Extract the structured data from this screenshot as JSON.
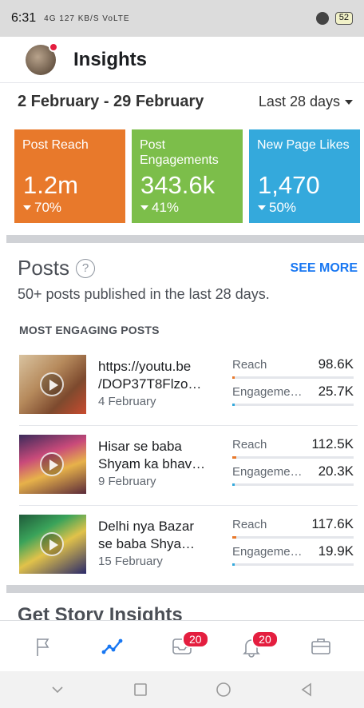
{
  "status_bar": {
    "time": "6:31",
    "indicators": "4G 127 KB/S VoLTE",
    "battery": "52"
  },
  "header": {
    "title": "Insights"
  },
  "date_row": {
    "range": "2 February - 29 February",
    "period": "Last 28 days"
  },
  "cards": [
    {
      "label": "Post Reach",
      "value": "1.2m",
      "change": "70%",
      "color": "#e8792b"
    },
    {
      "label": "Post Engagements",
      "value": "343.6k",
      "change": "41%",
      "color": "#7cbe4a"
    },
    {
      "label": "New Page Likes",
      "value": "1,470",
      "change": "50%",
      "color": "#34a9dc"
    }
  ],
  "posts": {
    "title": "Posts",
    "help": "?",
    "see_more": "SEE MORE",
    "subtitle": "50+ posts published in the last 28 days.",
    "section_label": "MOST ENGAGING POSTS",
    "items": [
      {
        "title": "https://youtu.be\n/DOP37T8Flzo…",
        "date": "4 February",
        "reach_label": "Reach",
        "reach": "98.6K",
        "reach_fill": 0.02,
        "engagement_label": "Engageme…",
        "engagement": "25.7K",
        "engagement_fill": 0.02
      },
      {
        "title": "Hisar se baba\nShyam ka bhav…",
        "date": "9 February",
        "reach_label": "Reach",
        "reach": "112.5K",
        "reach_fill": 0.03,
        "engagement_label": "Engageme…",
        "engagement": "20.3K",
        "engagement_fill": 0.02
      },
      {
        "title": "Delhi nya Bazar\nse baba Shya…",
        "date": "15 February",
        "reach_label": "Reach",
        "reach": "117.6K",
        "reach_fill": 0.03,
        "engagement_label": "Engageme…",
        "engagement": "19.9K",
        "engagement_fill": 0.02
      }
    ]
  },
  "story": {
    "title": "Get Story Insights"
  },
  "bottom_nav": {
    "inbox_badge": "20",
    "notifications_badge": "20",
    "active_color": "#1877f2"
  }
}
